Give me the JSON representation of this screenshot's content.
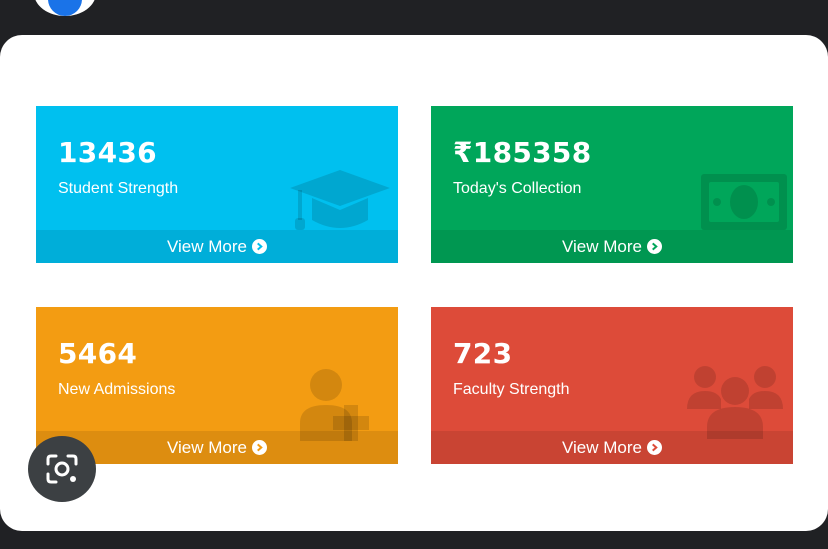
{
  "cards": [
    {
      "value": "13436",
      "label": "Student Strength",
      "footer": "View More",
      "icon": "graduation-cap-icon",
      "color": "#00c0ef"
    },
    {
      "value": "₹185358",
      "label": "Today's Collection",
      "footer": "View More",
      "icon": "money-icon",
      "color": "#00a65a"
    },
    {
      "value": "5464",
      "label": "New Admissions",
      "footer": "View More",
      "icon": "user-plus-icon",
      "color": "#f39c12"
    },
    {
      "value": "723",
      "label": "Faculty Strength",
      "footer": "View More",
      "icon": "users-icon",
      "color": "#dd4b39"
    }
  ],
  "overlay": {
    "lens_icon": "google-lens-icon"
  }
}
